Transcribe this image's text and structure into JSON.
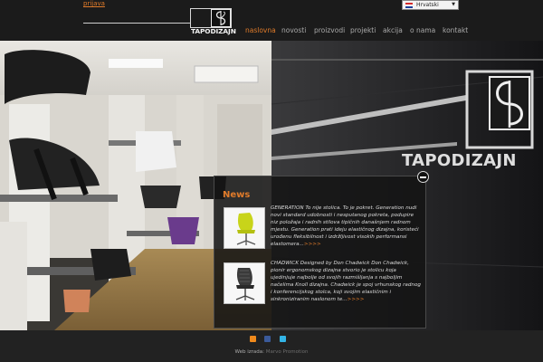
{
  "header": {
    "login_link": "prijava",
    "brand": "TAPODIZAJN",
    "language": "Hrvatski"
  },
  "nav": {
    "items": [
      {
        "label": "naslovna",
        "active": true
      },
      {
        "label": "novosti",
        "active": false
      },
      {
        "label": "proizvodi",
        "active": false
      },
      {
        "label": "projekti",
        "active": false
      },
      {
        "label": "akcija",
        "active": false
      },
      {
        "label": "o nama",
        "active": false
      },
      {
        "label": "kontakt",
        "active": false
      }
    ]
  },
  "hero": {
    "wall_sign": "TAPODIZAJN"
  },
  "news": {
    "title": "News",
    "items": [
      {
        "text": "GENERATION To nije stolica. To je pokret. Generation nudi novi standard udobnosti i nesputanog pokreta, podupire niz položaja i radnih stilova tipičnih današnjem radnom mjestu. Generation prati ideju elastičnog dizajna, koristeći urođenu fleksibilnost i izdržljivost visokih performansi elastomera...",
        "more": ">>>>",
        "image": "green-office-chair"
      },
      {
        "text": "CHADWICK Designed by Don Chadwick   Don Chadwick, pionir ergonomskog dizajna stvorio je stolicu koja ujedinjuje najbolje od svojih razmišljanja s najboljim načelima Knoll dizajna. Chadwick je spoj vrhunskog radnog i konferencijskog stolca, koji svojim elastičnim i sinkroniziranim naslonom te...",
        "more": ">>>>",
        "image": "black-mesh-office-chair"
      }
    ]
  },
  "footer": {
    "social_icons": [
      "rss-icon",
      "facebook-icon",
      "twitter-icon"
    ],
    "credit_label": "Web izrada:",
    "credit_author": "Marvo Promotion"
  },
  "colors": {
    "accent": "#e07b2a",
    "nav_text": "#a9a9a9",
    "background": "#2b2b2b"
  }
}
